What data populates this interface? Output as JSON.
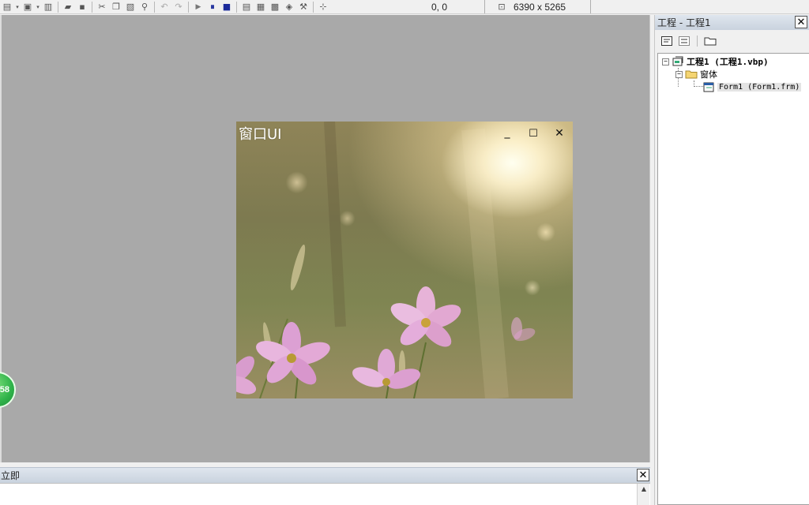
{
  "toolbar": {
    "coord_readout": "0, 0",
    "size_readout": "6390 x 5265"
  },
  "form": {
    "title": "窗口UI",
    "minimize_glyph": "_",
    "maximize_glyph": "☐",
    "close_glyph": "✕"
  },
  "badge": {
    "text": "58"
  },
  "immediate": {
    "title": "立即",
    "close_glyph": "✕"
  },
  "project": {
    "title": "工程 - 工程1",
    "close_glyph": "✕",
    "tree": {
      "root_label": "工程1 (工程1.vbp)",
      "folder_label": "窗体",
      "form_label": "Form1 (Form1.frm)"
    }
  },
  "colors": {
    "design_background": "#a9a9a9",
    "header_gradient_top": "#dfe6ee",
    "header_gradient_bottom": "#c9d3de"
  }
}
